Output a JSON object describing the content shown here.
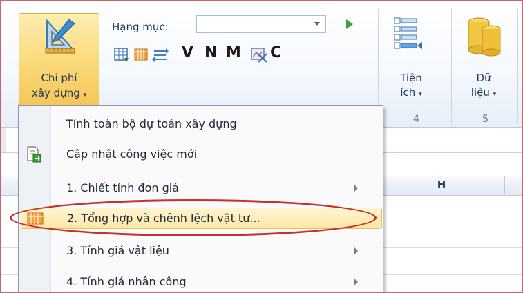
{
  "ribbon": {
    "chi_phi": {
      "label_line1": "Chi phí",
      "label_line2": "xây dựng",
      "caret": "▾",
      "icon": "triangle-ruler-pencil-icon"
    },
    "hang_muc": {
      "label": "Hạng mục:",
      "value": ""
    },
    "toolbar_letters": [
      "V",
      "N",
      "M",
      "C"
    ],
    "tien_ich": {
      "label_line1": "Tiện",
      "label_line2": "ích",
      "caret": "▾",
      "group": "4",
      "icon": "list-tool-icon"
    },
    "du_lieu": {
      "label_line1": "Dữ",
      "label_line2": "liệu",
      "caret": "▾",
      "group": "5",
      "icon": "database-icon"
    }
  },
  "sheet": {
    "column_header": "H"
  },
  "menu": {
    "items": [
      {
        "label": "Tính toàn bộ dự toán xây dựng",
        "submenu": false
      },
      {
        "label": "Cập nhật công việc mới",
        "submenu": false,
        "icon": "update-document-icon"
      },
      {
        "label": "1. Chiết tính đơn giá",
        "submenu": true
      },
      {
        "label": "2. Tổng hợp và chênh lệch vật tư...",
        "submenu": false,
        "highlighted": true,
        "icon": "table-icon"
      },
      {
        "label": "3. Tính giá vật liệu",
        "submenu": true
      },
      {
        "label": "4. Tính giá nhân công",
        "submenu": true
      }
    ]
  },
  "colors": {
    "highlight_ring": "#c8302c",
    "button_active": "#fbd979",
    "ribbon_text": "#1e395b"
  }
}
